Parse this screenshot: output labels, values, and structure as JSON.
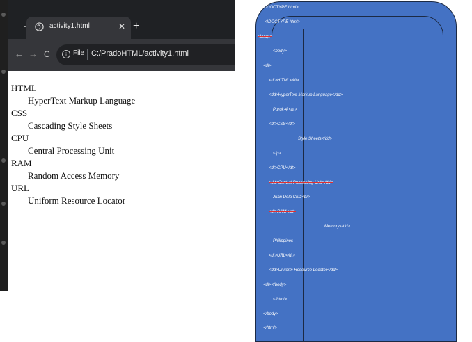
{
  "browser": {
    "tab_title": "activity1.html",
    "tab_close_glyph": "✕",
    "new_tab_glyph": "+",
    "tab_menu_glyph": "⌄",
    "nav": {
      "back_glyph": "←",
      "forward_glyph": "→",
      "reload_glyph": "C"
    },
    "omnibox": {
      "info_glyph": "i",
      "chip_label": "File",
      "url": "C:/PradoHTML/activity1.html"
    },
    "icons": [
      "chevron-down-icon",
      "globe-icon",
      "close-icon",
      "plus-icon",
      "back-arrow-icon",
      "forward-arrow-icon",
      "reload-icon",
      "info-icon"
    ],
    "colors": {
      "tabstrip": "#1f2124",
      "tab": "#35363a",
      "toolbar": "#35363a",
      "omnibox": "#202124"
    }
  },
  "content": {
    "terms": [
      {
        "term": "HTML",
        "definition": "HyperText Markup Language"
      },
      {
        "term": "CSS",
        "definition": "Cascading Style Sheets"
      },
      {
        "term": "CPU",
        "definition": "Central Processing Unit"
      },
      {
        "term": "RAM",
        "definition": "Random Access Memory"
      },
      {
        "term": "URL",
        "definition": "Uniform Resource Locator"
      }
    ]
  },
  "code": {
    "lines": [
      "<!DOCTYPE  html>",
      "<!DOCTYPE  html>",
      "<body>",
      "<body>",
      "<dl>",
      "<dt>H TML</dt>",
      "<dd>HyperText Markup Language</dd>",
      "Purok-4 <br>",
      "<dt>CSS</dt>",
      "Style Sheets</dd>",
      "</p>",
      "<dt>CPU</dt>",
      "<dd>Central Processing Unit</dd>",
      "Juan Dela Cruz<br>",
      "<dt>RAM</dt>",
      "Memory</dd>",
      "Philippines",
      "<dt>URL</dt>",
      "<dd>Uniform  Resource Locator</dd>",
      "<dl></body>",
      "</html>",
      "</body>",
      "</html>"
    ],
    "colors": {
      "card": "#4472c4",
      "outline": "#1c2a44",
      "strike": "#e03030"
    }
  }
}
